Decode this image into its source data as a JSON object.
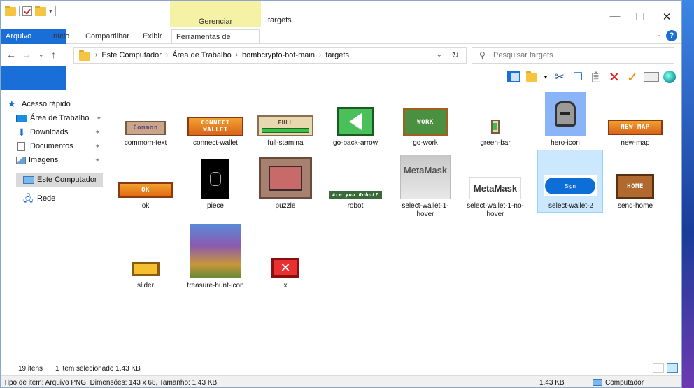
{
  "window": {
    "title": "targets",
    "manage_context": "Gerenciar",
    "controls": {
      "minimize": "—",
      "maximize": "☐",
      "close": "✕"
    }
  },
  "ribbon": {
    "tabs": [
      "Arquivo",
      "Início",
      "Compartilhar",
      "Exibir",
      "Ferramentas de Imagem"
    ],
    "help": "?"
  },
  "address": {
    "crumbs": [
      "Este Computador",
      "Área de Trabalho",
      "bombcrypto-bot-main",
      "targets"
    ],
    "search_placeholder": "Pesquisar targets"
  },
  "sidebar": {
    "items": [
      {
        "label": "Acesso rápido",
        "icon": "star-icon"
      },
      {
        "label": "Área de Trabalho",
        "icon": "desktop-icon",
        "pinned": true
      },
      {
        "label": "Downloads",
        "icon": "download-icon",
        "pinned": true
      },
      {
        "label": "Documentos",
        "icon": "document-icon",
        "pinned": true
      },
      {
        "label": "Imagens",
        "icon": "pictures-icon",
        "pinned": true
      },
      {
        "label": "Este Computador",
        "icon": "computer-icon",
        "selected": true
      },
      {
        "label": "Rede",
        "icon": "network-icon"
      }
    ]
  },
  "files": [
    {
      "name": "commom-text",
      "thumb_text": "Common"
    },
    {
      "name": "connect-wallet",
      "thumb_text": "CONNECT WALLET"
    },
    {
      "name": "full-stamina",
      "thumb_text": "FULL"
    },
    {
      "name": "go-back-arrow",
      "thumb_text": ""
    },
    {
      "name": "go-work",
      "thumb_text": "WORK"
    },
    {
      "name": "green-bar",
      "thumb_text": ""
    },
    {
      "name": "hero-icon",
      "thumb_text": ""
    },
    {
      "name": "new-map",
      "thumb_text": "NEW MAP"
    },
    {
      "name": "ok",
      "thumb_text": "OK"
    },
    {
      "name": "piece",
      "thumb_text": ""
    },
    {
      "name": "puzzle",
      "thumb_text": ""
    },
    {
      "name": "robot",
      "thumb_text": "Are you Robot?"
    },
    {
      "name": "select-wallet-1-hover",
      "thumb_text": "MetaMask"
    },
    {
      "name": "select-wallet-1-no-hover",
      "thumb_text": "MetaMask"
    },
    {
      "name": "select-wallet-2",
      "thumb_text": "Sign",
      "selected": true
    },
    {
      "name": "send-home",
      "thumb_text": "HOME"
    },
    {
      "name": "slider",
      "thumb_text": ""
    },
    {
      "name": "treasure-hunt-icon",
      "thumb_text": ""
    },
    {
      "name": "x",
      "thumb_text": ""
    }
  ],
  "status": {
    "count": "19 itens",
    "selection": "1 item selecionado  1,43 KB",
    "details": "Tipo de item: Arquivo PNG, Dimensões: 143 x 68, Tamanho: 1,43 KB",
    "size": "1,43 KB",
    "location": "Computador"
  }
}
